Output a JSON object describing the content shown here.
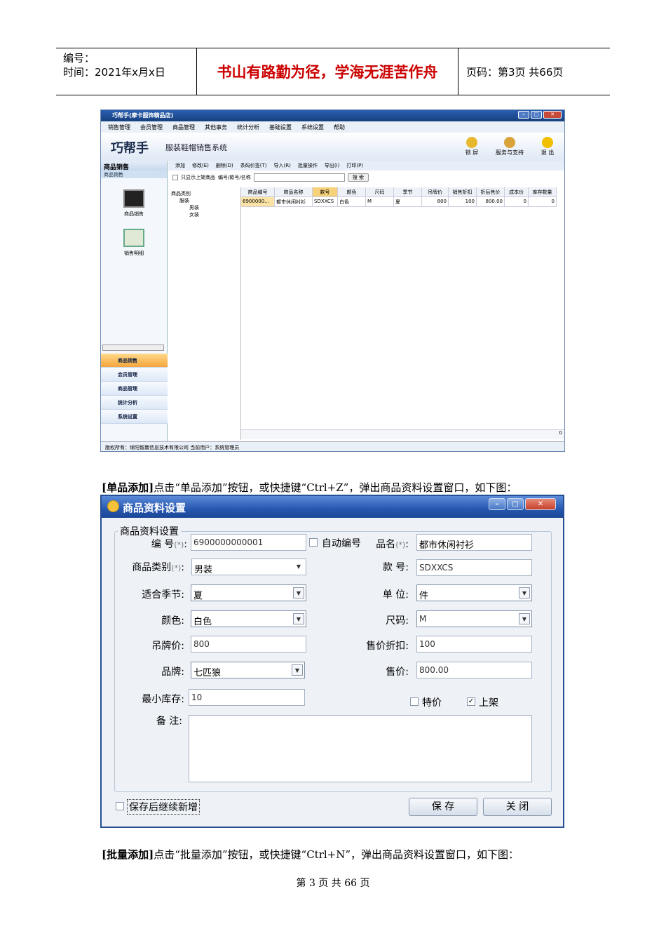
{
  "header": {
    "code_label": "编号：",
    "date_label": "时间：2021年x月x日",
    "motto": "书山有路勤为径，学海无涯苦作舟",
    "page_label": "页码：第3页  共66页"
  },
  "app": {
    "title": "巧帮手(摩卡服饰精品店)",
    "menu": [
      "销售管理",
      "会员管理",
      "商品管理",
      "其他事务",
      "统计分析",
      "基础设置",
      "系统设置",
      "帮助"
    ],
    "logo": "巧帮手",
    "system_name": "服装鞋帽销售系统",
    "tools": [
      {
        "label": "锁 屏",
        "color": "#e8b730"
      },
      {
        "label": "服务与支持",
        "color": "#d9a33a"
      },
      {
        "label": "退 出",
        "color": "#f0c000"
      }
    ],
    "left_header": "商品销售",
    "left_sub": "商品销售",
    "left_items": [
      "商品销售",
      "销售明细"
    ],
    "nav": [
      "商品销售",
      "会员管理",
      "商品管理",
      "统计分析",
      "系统设置"
    ],
    "toolbar": [
      "添加",
      "修改(E)",
      "删除(D)",
      "条码价签(T)",
      "导入(R)",
      "批量操作",
      "导出(I)",
      "打印(P)"
    ],
    "filter_label": "只显示上架商品",
    "filter_field": "编号/款号/名称",
    "search_btn": "搜 索",
    "tree": [
      "商品类别",
      "服装",
      "男装",
      "女装"
    ],
    "columns": [
      "商品编号",
      "商品名称",
      "款号",
      "颜色",
      "尺码",
      "季节",
      "吊牌价",
      "销售折扣",
      "折后售价",
      "成本价",
      "库存数量"
    ],
    "row": [
      "6900000...",
      "都市休闲衬衫",
      "SDXXCS",
      "白色",
      "M",
      "夏",
      "800",
      "100",
      "800.00",
      "0",
      "0"
    ],
    "grid_footer": "0",
    "status": "版权所有：绵阳智赢信息技术有限公司      当前用户：系统管理员"
  },
  "para1": {
    "bold": "[单品添加]",
    "text": "点击“单品添加”按钮，或快捷键“Ctrl+Z”，弹出商品资料设置窗口，如下图："
  },
  "dialog": {
    "title": "商品资料设置",
    "legend": "商品资料设置",
    "fields": {
      "code_label": "编 号",
      "code_value": "6900000000001",
      "auto_code": "自动编号",
      "name_label": "品名",
      "name_value": "都市休闲衬衫",
      "category_label": "商品类别",
      "category_value": "男装",
      "style_label": "款 号",
      "style_value": "SDXXCS",
      "season_label": "适合季节",
      "season_value": "夏",
      "unit_label": "单 位",
      "unit_value": "件",
      "color_label": "颜色",
      "color_value": "白色",
      "size_label": "尺码",
      "size_value": "M",
      "tag_label": "吊牌价",
      "tag_value": "800",
      "discount_label": "售价折扣",
      "discount_value": "100",
      "brand_label": "品牌",
      "brand_value": "七匹狼",
      "price_label": "售价",
      "price_value": "800.00",
      "minstock_label": "最小库存",
      "minstock_value": "10",
      "special_label": "特价",
      "onshelf_label": "上架",
      "note_label": "备 注"
    },
    "required_mark": "(*)",
    "continue_label": "保存后继续新增",
    "save_btn": "保 存",
    "close_btn": "关 闭"
  },
  "para2": {
    "bold": "[批量添加]",
    "text": "点击“批量添加”按钮，或快捷键“Ctrl+N”，弹出商品资料设置窗口，如下图："
  },
  "footer": "第 3 页 共 66 页"
}
